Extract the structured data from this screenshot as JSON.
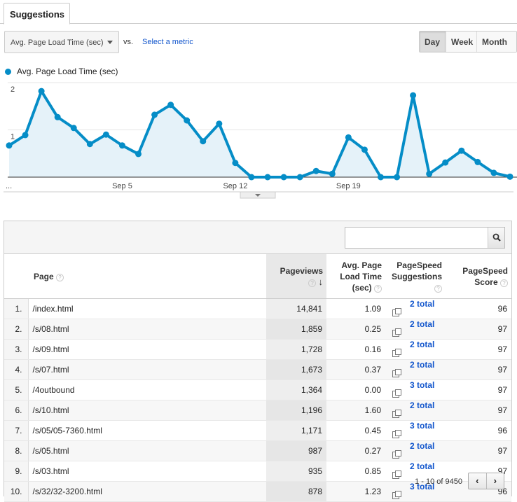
{
  "tabs": [
    {
      "label": "Suggestions"
    }
  ],
  "controls": {
    "metric_selected": "Avg. Page Load Time (sec)",
    "vs_label": "vs.",
    "select_metric_label": "Select a metric",
    "period_buttons": [
      {
        "label": "Day",
        "active": true
      },
      {
        "label": "Week",
        "active": false
      },
      {
        "label": "Month",
        "active": false
      }
    ]
  },
  "legend": {
    "label": "Avg. Page Load Time (sec)",
    "color": "#058dc7"
  },
  "chart_data": {
    "type": "area",
    "title": "",
    "series": [
      {
        "name": "Avg. Page Load Time (sec)",
        "color": "#058dc7",
        "values": [
          0.67,
          0.89,
          1.82,
          1.27,
          1.04,
          0.7,
          0.9,
          0.67,
          0.49,
          1.32,
          1.53,
          1.2,
          0.76,
          1.13,
          0.3,
          0.0,
          0.0,
          0.0,
          0.0,
          0.13,
          0.07,
          0.84,
          0.58,
          0.0,
          0.0,
          1.73,
          0.07,
          0.31,
          0.56,
          0.32,
          0.09,
          0.01
        ]
      }
    ],
    "x_tick_labels": [
      {
        "index": 0,
        "label": "..."
      },
      {
        "index": 7,
        "label": "Sep 5"
      },
      {
        "index": 14,
        "label": "Sep 12"
      },
      {
        "index": 21,
        "label": "Sep 19"
      }
    ],
    "y_tick_labels": [
      "1",
      "2"
    ],
    "ylim": [
      0,
      2
    ],
    "grid": true
  },
  "table": {
    "search_placeholder": "",
    "columns": [
      {
        "label": "Page",
        "help": "?"
      },
      {
        "label": "Pageviews",
        "help": "?",
        "sorted": "desc"
      },
      {
        "label": "Avg. Page Load Time (sec)",
        "help": "?"
      },
      {
        "label": "PageSpeed Suggestions",
        "help": "?"
      },
      {
        "label": "PageSpeed Score",
        "help": "?"
      }
    ],
    "header_lines": {
      "page": "Page",
      "pageviews": "Pageviews",
      "loadtime_1": "Avg. Page",
      "loadtime_2": "Load Time",
      "loadtime_3": "(sec)",
      "sugg_1": "PageSpeed",
      "sugg_2": "Suggestions",
      "score_1": "PageSpeed",
      "score_2": "Score",
      "sort_arrow": "↓"
    },
    "rows": [
      {
        "index": "1.",
        "page": "/index.html",
        "pageviews": "14,841",
        "load_time": "1.09",
        "suggestions": "2 total",
        "score": "96"
      },
      {
        "index": "2.",
        "page": "/s/08.html",
        "pageviews": "1,859",
        "load_time": "0.25",
        "suggestions": "2 total",
        "score": "97"
      },
      {
        "index": "3.",
        "page": "/s/09.html",
        "pageviews": "1,728",
        "load_time": "0.16",
        "suggestions": "2 total",
        "score": "97"
      },
      {
        "index": "4.",
        "page": "/s/07.html",
        "pageviews": "1,673",
        "load_time": "0.37",
        "suggestions": "2 total",
        "score": "97"
      },
      {
        "index": "5.",
        "page": "/4outbound",
        "pageviews": "1,364",
        "load_time": "0.00",
        "suggestions": "3 total",
        "score": "97"
      },
      {
        "index": "6.",
        "page": "/s/10.html",
        "pageviews": "1,196",
        "load_time": "1.60",
        "suggestions": "2 total",
        "score": "97"
      },
      {
        "index": "7.",
        "page": "/s/05/05-7360.html",
        "pageviews": "1,171",
        "load_time": "0.45",
        "suggestions": "3 total",
        "score": "96"
      },
      {
        "index": "8.",
        "page": "/s/05.html",
        "pageviews": "987",
        "load_time": "0.27",
        "suggestions": "2 total",
        "score": "97"
      },
      {
        "index": "9.",
        "page": "/s/03.html",
        "pageviews": "935",
        "load_time": "0.85",
        "suggestions": "2 total",
        "score": "97"
      },
      {
        "index": "10.",
        "page": "/s/32/32-3200.html",
        "pageviews": "878",
        "load_time": "1.23",
        "suggestions": "3 total",
        "score": "96"
      }
    ],
    "pagination": {
      "text": "1 - 10 of 9450",
      "prev": "‹",
      "next": "›"
    }
  }
}
